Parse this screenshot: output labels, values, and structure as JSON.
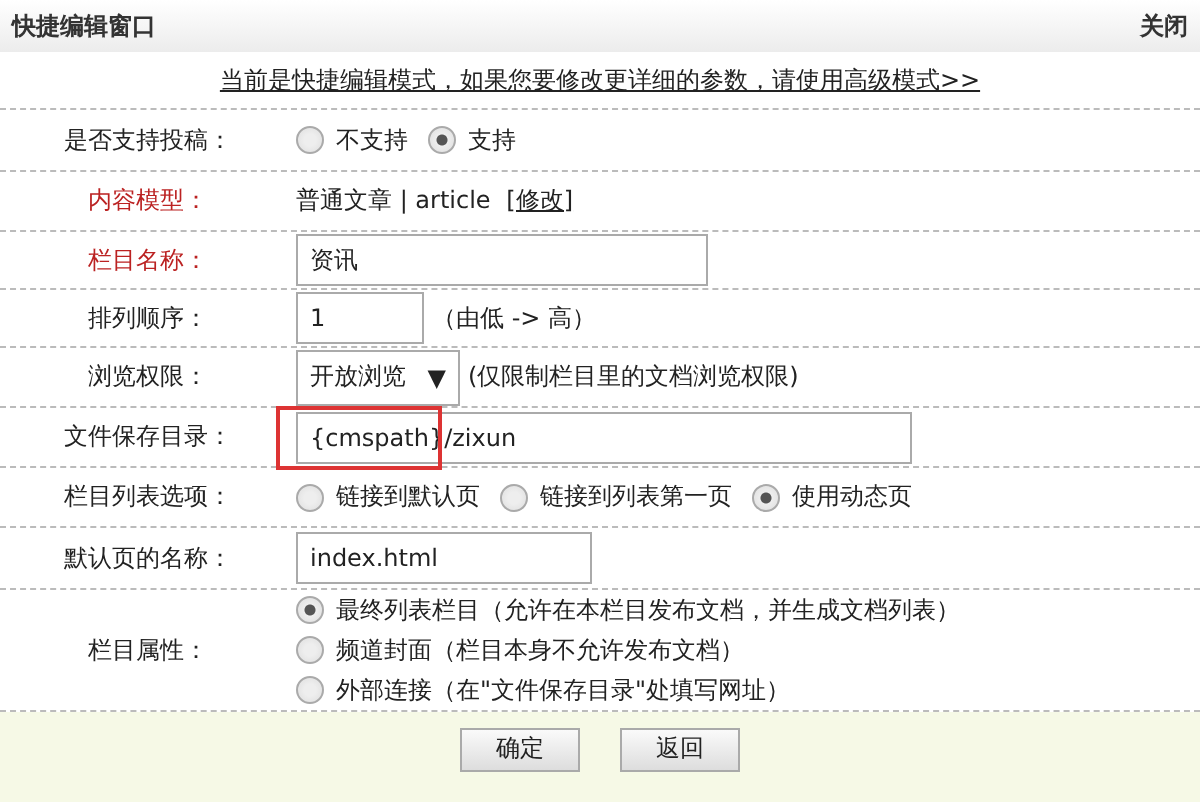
{
  "window": {
    "title": "快捷编辑窗口",
    "close": "关闭"
  },
  "notice": "当前是快捷编辑模式，如果您要修改更详细的参数，请使用高级模式>>",
  "rows": [
    {
      "kind": "radios",
      "label": "是否支持投稿：",
      "required": false,
      "options": [
        {
          "label": "不支持",
          "selected": false
        },
        {
          "label": "支持",
          "selected": true
        }
      ]
    },
    {
      "kind": "text",
      "label": "内容模型：",
      "required": true,
      "text": "普通文章 | article ",
      "link": "[修改]"
    },
    {
      "kind": "input",
      "label": "栏目名称：",
      "required": true,
      "value": "资讯"
    },
    {
      "kind": "input",
      "label": "排列顺序：",
      "required": false,
      "value": "1",
      "note": "（由低 -> 高）"
    },
    {
      "kind": "select",
      "label": "浏览权限：",
      "required": false,
      "value": "开放浏览",
      "arrow": "▼",
      "note": "(仅限制栏目里的文档浏览权限)"
    },
    {
      "kind": "input",
      "label": "文件保存目录：",
      "required": false,
      "value": "{cmspath}/zixun",
      "highlighted": true
    },
    {
      "kind": "radios",
      "label": "栏目列表选项：",
      "required": false,
      "options": [
        {
          "label": "链接到默认页",
          "selected": false
        },
        {
          "label": "链接到列表第一页",
          "selected": false
        },
        {
          "label": "使用动态页",
          "selected": true
        }
      ]
    },
    {
      "kind": "input",
      "label": "默认页的名称：",
      "required": false,
      "value": "index.html"
    },
    {
      "kind": "stacked",
      "label": "栏目属性：",
      "required": false,
      "options": [
        {
          "label": "最终列表栏目（允许在本栏目发布文档，并生成文档列表）",
          "selected": true
        },
        {
          "label": "频道封面（栏目本身不允许发布文档）",
          "selected": false
        },
        {
          "label": "外部连接（在\"文件保存目录\"处填写网址）",
          "selected": false
        }
      ]
    }
  ],
  "buttons": [
    "确定",
    "返回"
  ]
}
